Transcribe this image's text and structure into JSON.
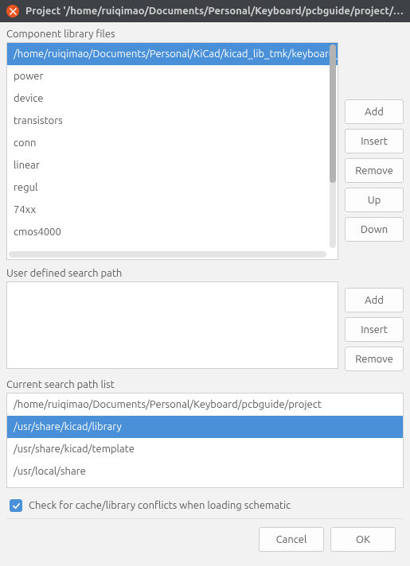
{
  "window": {
    "title": "Project '/home/ruiqimao/Documents/Personal/Keyboard/pcbguide/project/exampl..."
  },
  "lib_files": {
    "label": "Component library files",
    "items": [
      "/home/ruiqimao/Documents/Personal/KiCad/kicad_lib_tmk/keyboard_parts",
      "power",
      "device",
      "transistors",
      "conn",
      "linear",
      "regul",
      "74xx",
      "cmos4000"
    ],
    "selected_index": 0,
    "buttons": {
      "add": "Add",
      "insert": "Insert",
      "remove": "Remove",
      "up": "Up",
      "down": "Down"
    }
  },
  "user_paths": {
    "label": "User defined search path",
    "items": [],
    "buttons": {
      "add": "Add",
      "insert": "Insert",
      "remove": "Remove"
    }
  },
  "current_paths": {
    "label": "Current search path list",
    "items": [
      "/home/ruiqimao/Documents/Personal/Keyboard/pcbguide/project",
      "/usr/share/kicad/library",
      "/usr/share/kicad/template",
      "/usr/local/share"
    ],
    "selected_index": 1
  },
  "checkbox": {
    "label": "Check for cache/library conflicts when loading schematic",
    "checked": true
  },
  "footer": {
    "cancel": "Cancel",
    "ok": "OK"
  },
  "colors": {
    "selection": "#4a90d9",
    "titlebar": "#3e4246"
  }
}
